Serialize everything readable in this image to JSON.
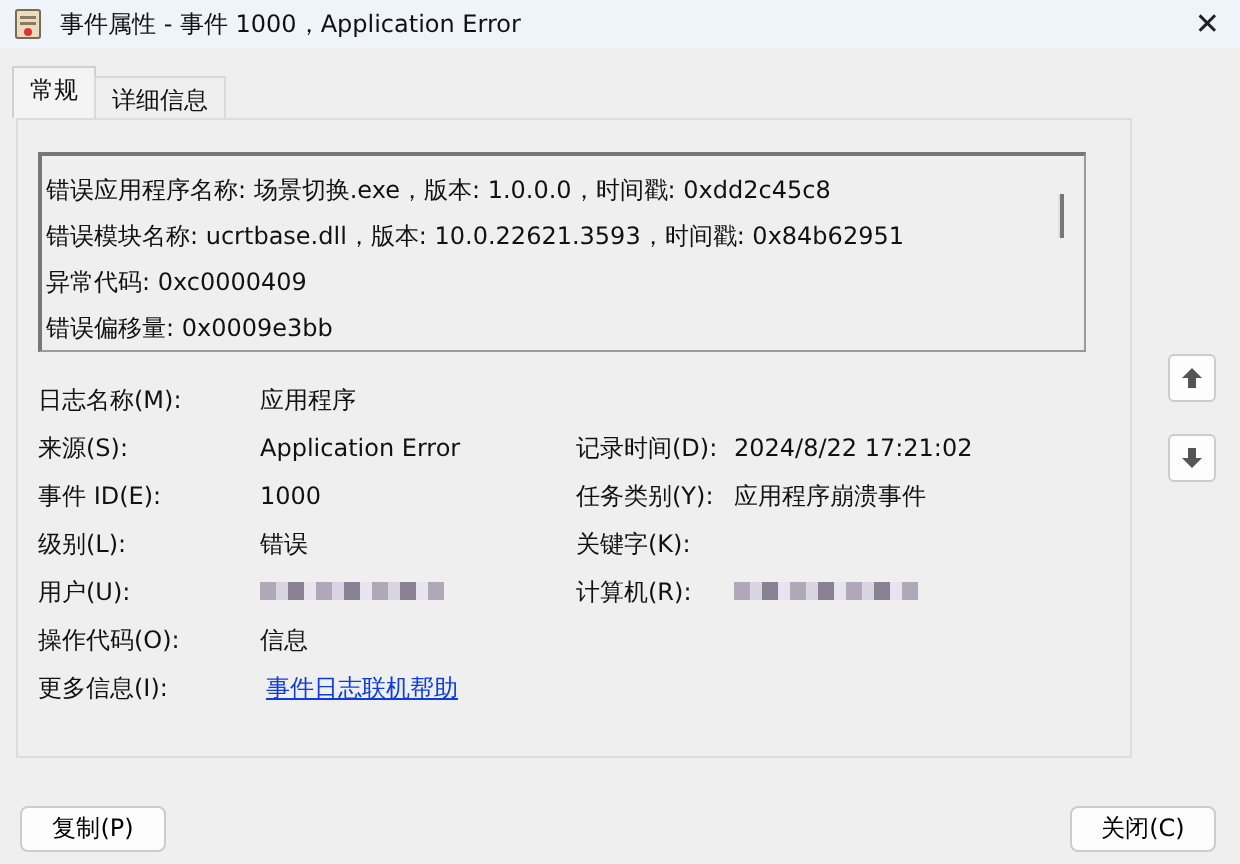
{
  "window": {
    "title": "事件属性 - 事件 1000，Application Error",
    "close": "✕"
  },
  "tabs": [
    {
      "label": "常规",
      "selected": true
    },
    {
      "label": "详细信息",
      "selected": false
    }
  ],
  "description": [
    "错误应用程序名称: 场景切换.exe，版本: 1.0.0.0，时间戳: 0xdd2c45c8",
    "错误模块名称: ucrtbase.dll，版本: 10.0.22621.3593，时间戳: 0x84b62951",
    "异常代码: 0xc0000409",
    "错误偏移量: 0x0009e3bb"
  ],
  "rows": [
    {
      "left": {
        "label": "日志名称(M):",
        "kind": "text",
        "value": "应用程序"
      }
    },
    {
      "left": {
        "label": "来源(S):",
        "kind": "text",
        "value": "Application Error"
      },
      "right": {
        "label": "记录时间(D):",
        "kind": "text",
        "value": "2024/8/22 17:21:02"
      }
    },
    {
      "left": {
        "label": "事件 ID(E):",
        "kind": "text",
        "value": "1000"
      },
      "right": {
        "label": "任务类别(Y):",
        "kind": "text",
        "value": "应用程序崩溃事件"
      }
    },
    {
      "left": {
        "label": "级别(L):",
        "kind": "text",
        "value": "错误"
      },
      "right": {
        "label": "关键字(K):",
        "kind": "text"
      }
    },
    {
      "left": {
        "label": "用户(U):",
        "kind": "redacted"
      },
      "right": {
        "label": "计算机(R):",
        "kind": "redacted"
      }
    },
    {
      "left": {
        "label": "操作代码(O):",
        "kind": "text",
        "value": "信息"
      }
    },
    {
      "left": {
        "label": "更多信息(I):",
        "kind": "link",
        "value": "事件日志联机帮助"
      }
    }
  ],
  "buttons": [
    {
      "label": "复制(P)"
    },
    {
      "label": "关闭(C)"
    }
  ]
}
